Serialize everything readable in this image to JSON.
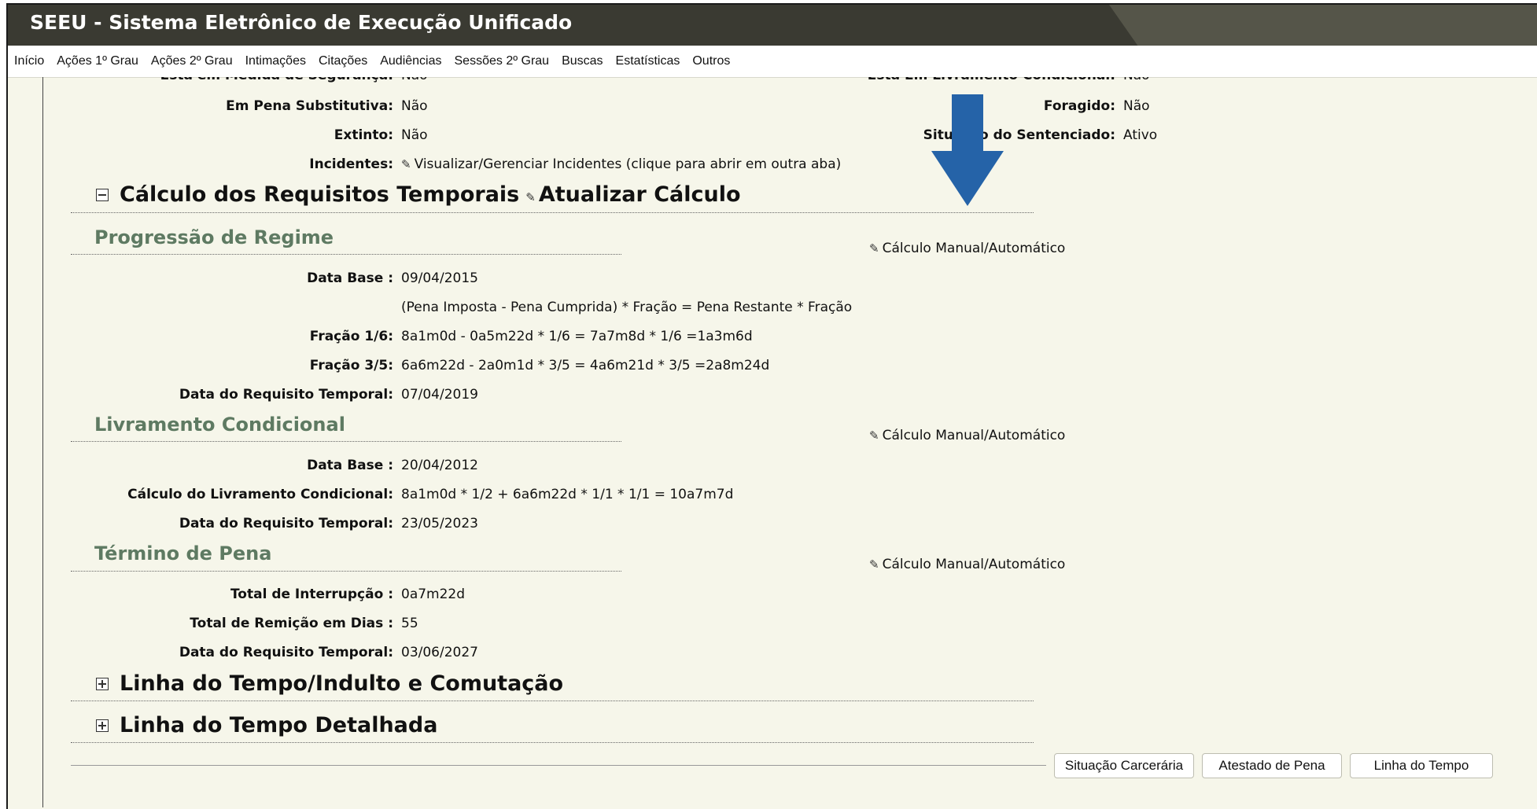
{
  "app": {
    "title": "SEEU - Sistema Eletrônico de Execução Unificado"
  },
  "menu": [
    "Início",
    "Ações 1º Grau",
    "Ações 2º Grau",
    "Intimações",
    "Citações",
    "Audiências",
    "Sessões 2º Grau",
    "Buscas",
    "Estatísticas",
    "Outros"
  ],
  "top_fields": {
    "medida_label": "Está em Medida de Segurança:",
    "medida_value": "Não",
    "livramento_label": "Está Em Livramento Condicional:",
    "livramento_value": "Não",
    "substitutiva_label": "Em Pena Substitutiva:",
    "substitutiva_value": "Não",
    "foragido_label": "Foragido:",
    "foragido_value": "Não",
    "extinto_label": "Extinto:",
    "extinto_value": "Não",
    "situacao_label": "Situação do Sentenciado:",
    "situacao_value": "Ativo",
    "incidentes_label": "Incidentes:",
    "incidentes_link": "Visualizar/Gerenciar Incidentes (clique para abrir em outra aba)"
  },
  "calc_section": {
    "title": "Cálculo dos Requisitos Temporais",
    "update_link": "Atualizar Cálculo"
  },
  "manual_link": "Cálculo Manual/Automático",
  "progressao": {
    "title": "Progressão de Regime",
    "data_base_label": "Data Base :",
    "data_base_value": "09/04/2015",
    "formula": "(Pena Imposta - Pena Cumprida) * Fração = Pena Restante * Fração",
    "fracao16_label": "Fração 1/6:",
    "fracao16_value": "8a1m0d - 0a5m22d * 1/6 = 7a7m8d * 1/6 =1a3m6d",
    "fracao35_label": "Fração 3/5:",
    "fracao35_value": "6a6m22d - 2a0m1d * 3/5 = 4a6m21d * 3/5 =2a8m24d",
    "req_label": "Data do Requisito Temporal:",
    "req_value": "07/04/2019"
  },
  "livramento": {
    "title": "Livramento Condicional",
    "data_base_label": "Data Base :",
    "data_base_value": "20/04/2012",
    "calc_label": "Cálculo do Livramento Condicional:",
    "calc_value": "8a1m0d * 1/2 + 6a6m22d * 1/1 * 1/1 = 10a7m7d",
    "req_label": "Data do Requisito Temporal:",
    "req_value": "23/05/2023"
  },
  "termino": {
    "title": "Término de Pena",
    "interrupcao_label": "Total de Interrupção :",
    "interrupcao_value": "0a7m22d",
    "remicao_label": "Total de Remição em Dias :",
    "remicao_value": "55",
    "req_label": "Data do Requisito Temporal:",
    "req_value": "03/06/2027"
  },
  "collapsed_sections": [
    "Linha do Tempo/Indulto e Comutação",
    "Linha do Tempo Detalhada"
  ],
  "buttons": [
    "Situação Carcerária",
    "Atestado de Pena",
    "Linha do Tempo"
  ],
  "colors": {
    "header": "#3a3a32",
    "background": "#f6f6ea",
    "subheading": "#5e7a62",
    "arrow": "#2563a8"
  }
}
